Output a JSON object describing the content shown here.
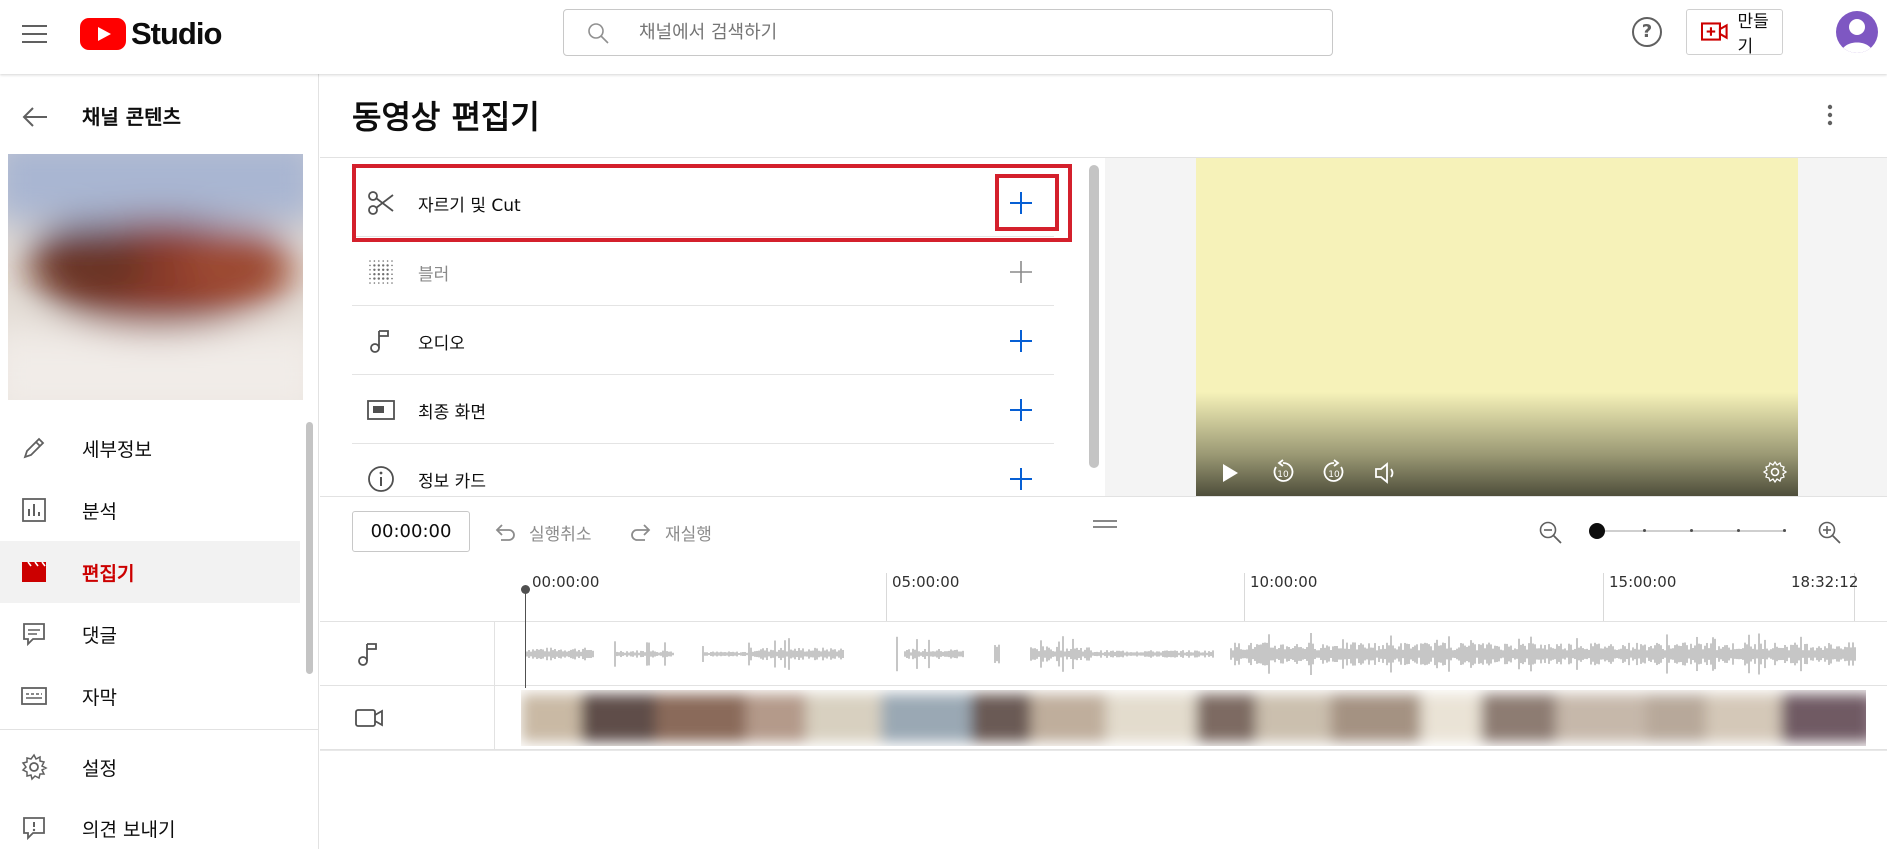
{
  "header": {
    "logo_text": "Studio",
    "search_placeholder": "채널에서 검색하기",
    "help_label": "?",
    "create_label": "만들기"
  },
  "sidebar": {
    "title": "채널 콘텐츠",
    "items": [
      {
        "label": "세부정보",
        "icon": "pencil-icon"
      },
      {
        "label": "분석",
        "icon": "analytics-icon"
      },
      {
        "label": "편집기",
        "icon": "clapperboard-icon",
        "active": true
      },
      {
        "label": "댓글",
        "icon": "comment-icon"
      },
      {
        "label": "자막",
        "icon": "subtitles-icon"
      },
      {
        "label": "설정",
        "icon": "gear-icon"
      },
      {
        "label": "의견 보내기",
        "icon": "feedback-icon"
      }
    ]
  },
  "main": {
    "page_title": "동영상 편집기",
    "tools": [
      {
        "label": "자르기 및 Cut",
        "icon": "scissors-icon",
        "enabled": true
      },
      {
        "label": "블러",
        "icon": "blur-icon",
        "enabled": false
      },
      {
        "label": "오디오",
        "icon": "music-note-icon",
        "enabled": true
      },
      {
        "label": "최종 화면",
        "icon": "end-screen-icon",
        "enabled": true
      },
      {
        "label": "정보 카드",
        "icon": "info-icon",
        "enabled": true
      }
    ]
  },
  "timeline": {
    "timecode": "00:00:00",
    "undo_label": "실행취소",
    "redo_label": "재실행",
    "ruler": [
      "00:00:00",
      "05:00:00",
      "10:00:00",
      "15:00:00",
      "18:32:12"
    ],
    "zoom_level_fraction": 0.0
  },
  "colors": {
    "brand_red": "#ff0000",
    "active_red": "#cc0000",
    "highlight_red": "#d4202c",
    "add_blue": "#065fd4",
    "preview_yellow": "#f6f2b9"
  }
}
